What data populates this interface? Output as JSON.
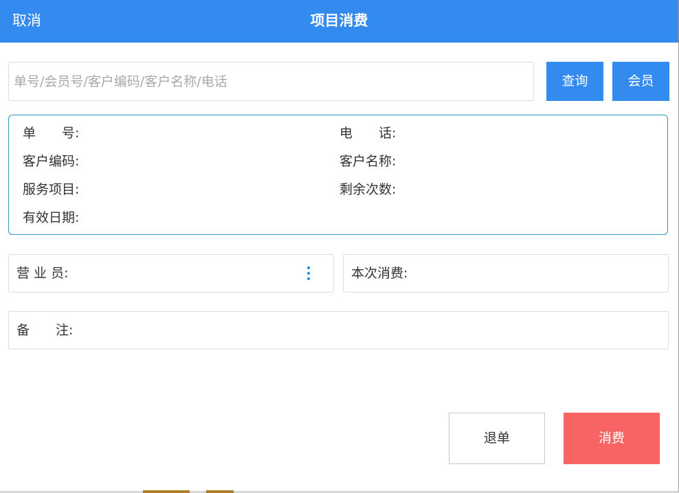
{
  "header": {
    "cancel_label": "取消",
    "title": "项目消费"
  },
  "search": {
    "value": "",
    "placeholder": "单号/会员号/客户编码/客户名称/电话",
    "query_label": "查询",
    "member_label": "会员"
  },
  "info": {
    "order_no_label": "单　　号:",
    "order_no_value": "",
    "phone_label": "电　　话:",
    "phone_value": "",
    "customer_code_label": "客户编码:",
    "customer_code_value": "",
    "customer_name_label": "客户名称:",
    "customer_name_value": "",
    "service_item_label": "服务项目:",
    "service_item_value": "",
    "remaining_times_label": "剩余次数:",
    "remaining_times_value": "",
    "valid_date_label": "有效日期:",
    "valid_date_value": ""
  },
  "form": {
    "salesperson_label": "营 业 员:",
    "salesperson_value": "",
    "consumption_label": "本次消费:",
    "consumption_value": "",
    "remark_label": "备　　注:",
    "remark_value": ""
  },
  "actions": {
    "refund_label": "退单",
    "consume_label": "消费"
  },
  "colors": {
    "primary": "#338bf0",
    "danger": "#f86464",
    "info_border": "#2a97c9"
  }
}
